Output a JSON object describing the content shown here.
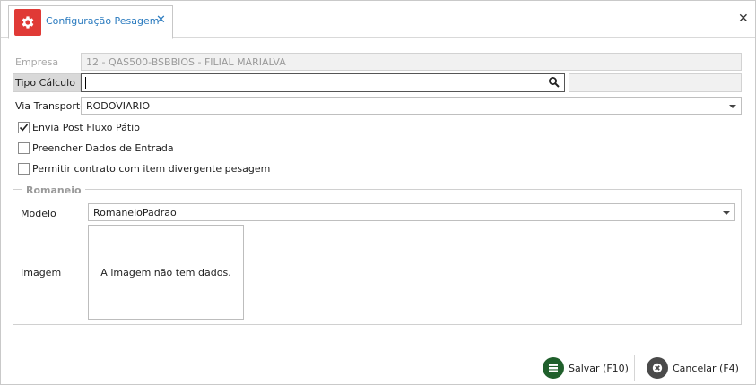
{
  "tab": {
    "title": "Configuração Pesagem",
    "close": "✕"
  },
  "window": {
    "close": "✕"
  },
  "form": {
    "empresa_label": "Empresa",
    "empresa_value": "12 - QAS500-BSBBIOS - FILIAL MARIALVA",
    "tipo_calculo_label": "Tipo Cálculo",
    "tipo_calculo_value": "",
    "via_transporte_label": "Via Transporte",
    "via_transporte_value": "RODOVIARIO"
  },
  "checkboxes": [
    {
      "label": "Envia Post Fluxo Pátio",
      "checked": true
    },
    {
      "label": "Preencher Dados de Entrada",
      "checked": false
    },
    {
      "label": "Permitir contrato com item divergente pesagem",
      "checked": false
    }
  ],
  "romaneio": {
    "title": "Romaneio",
    "modelo_label": "Modelo",
    "modelo_value": "RomaneioPadrao",
    "imagem_label": "Imagem",
    "imagem_placeholder": "A imagem não tem dados."
  },
  "footer": {
    "save_label": "Salvar (F10)",
    "cancel_label": "Cancelar (F4)"
  },
  "colors": {
    "tab_icon_bg": "#e03a36",
    "tab_text": "#2b7bbf",
    "save_icon": "#1f5f2b",
    "cancel_icon": "#4a4a4a"
  }
}
